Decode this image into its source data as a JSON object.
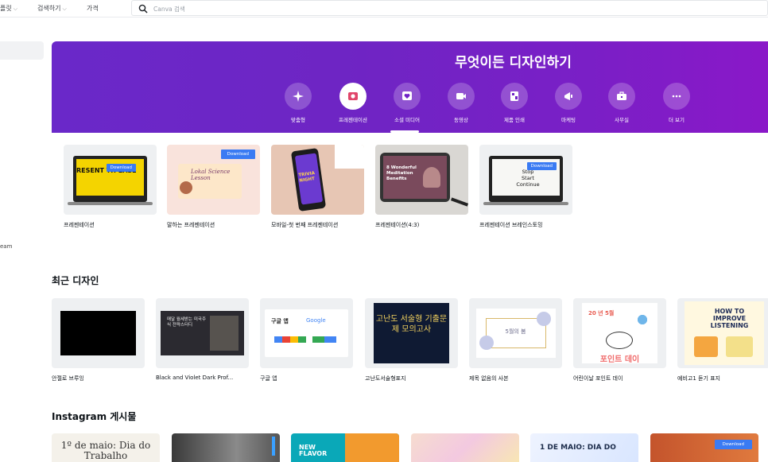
{
  "nav": {
    "item1": "플릿",
    "item2": "검색하기",
    "item3": "가격",
    "search_placeholder": "Canva 검색"
  },
  "sidebar": {
    "team_fragment": "eam"
  },
  "hero": {
    "title": "무엇이든 디자인하기",
    "categories": [
      {
        "label": "맞춤형",
        "icon": "sparkle-icon"
      },
      {
        "label": "프레젠테이션",
        "icon": "presentation-icon",
        "active": true
      },
      {
        "label": "소셜 미디어",
        "icon": "heart-icon"
      },
      {
        "label": "동영상",
        "icon": "video-icon"
      },
      {
        "label": "제품 인쇄",
        "icon": "print-icon"
      },
      {
        "label": "마케팅",
        "icon": "megaphone-icon"
      },
      {
        "label": "사무실",
        "icon": "briefcase-icon"
      },
      {
        "label": "더 보기",
        "icon": "more-icon"
      }
    ]
  },
  "templates": [
    {
      "name": "프레젠테이션",
      "thumb_text": "RESENT TH EASE",
      "badge": "Download"
    },
    {
      "name": "말하는 프레젠테이션",
      "thumb_text": "Lokal Science Lesson",
      "badge": "Download"
    },
    {
      "name": "모바일-첫 번째 프레젠테이션",
      "thumb_text": "TRIVIA NIGHT"
    },
    {
      "name": "프레젠테이션(4:3)",
      "thumb_text": "8 Wonderful Meditation Benefits"
    },
    {
      "name": "프레젠테이션 브레인스토밍",
      "thumb_text": "Stop Start Continue",
      "badge": "Download"
    }
  ],
  "recent": {
    "title": "최근 디자인",
    "items": [
      {
        "name": "안젤로 브루잉"
      },
      {
        "name": "Black and Violet Dark Prof...",
        "thumb_text": "매달 월세받는 미국주식 전략스터디"
      },
      {
        "name": "구글 앱",
        "thumb_text": "구글 앱",
        "thumb_logo": "Google"
      },
      {
        "name": "고난도서술형표지",
        "thumb_text": "고난도 서술형 기출문제 모의고사"
      },
      {
        "name": "제목 없음의 사본",
        "thumb_text": "5월의 봄"
      },
      {
        "name": "어린이날 포인트 데이",
        "thumb_text": "포인트 데이",
        "thumb_small": "20 년 5월"
      },
      {
        "name": "예비고1 듣기 표지",
        "thumb_text": "HOW TO IMPROVE LISTENING"
      }
    ]
  },
  "instagram": {
    "title": "Instagram 게시물",
    "items": [
      {
        "thumb_text": "1º de maio: Dia do Trabalho"
      },
      {
        "thumb_text": ""
      },
      {
        "thumb_text": "NEW FLAVOR"
      },
      {
        "thumb_text": ""
      },
      {
        "thumb_text": "1 DE MAIO: DIA DO"
      },
      {
        "thumb_text": "",
        "badge": "Download"
      }
    ]
  },
  "colors": {
    "hero_purple": "#7023c6",
    "badge_blue": "#3a7bf3"
  }
}
